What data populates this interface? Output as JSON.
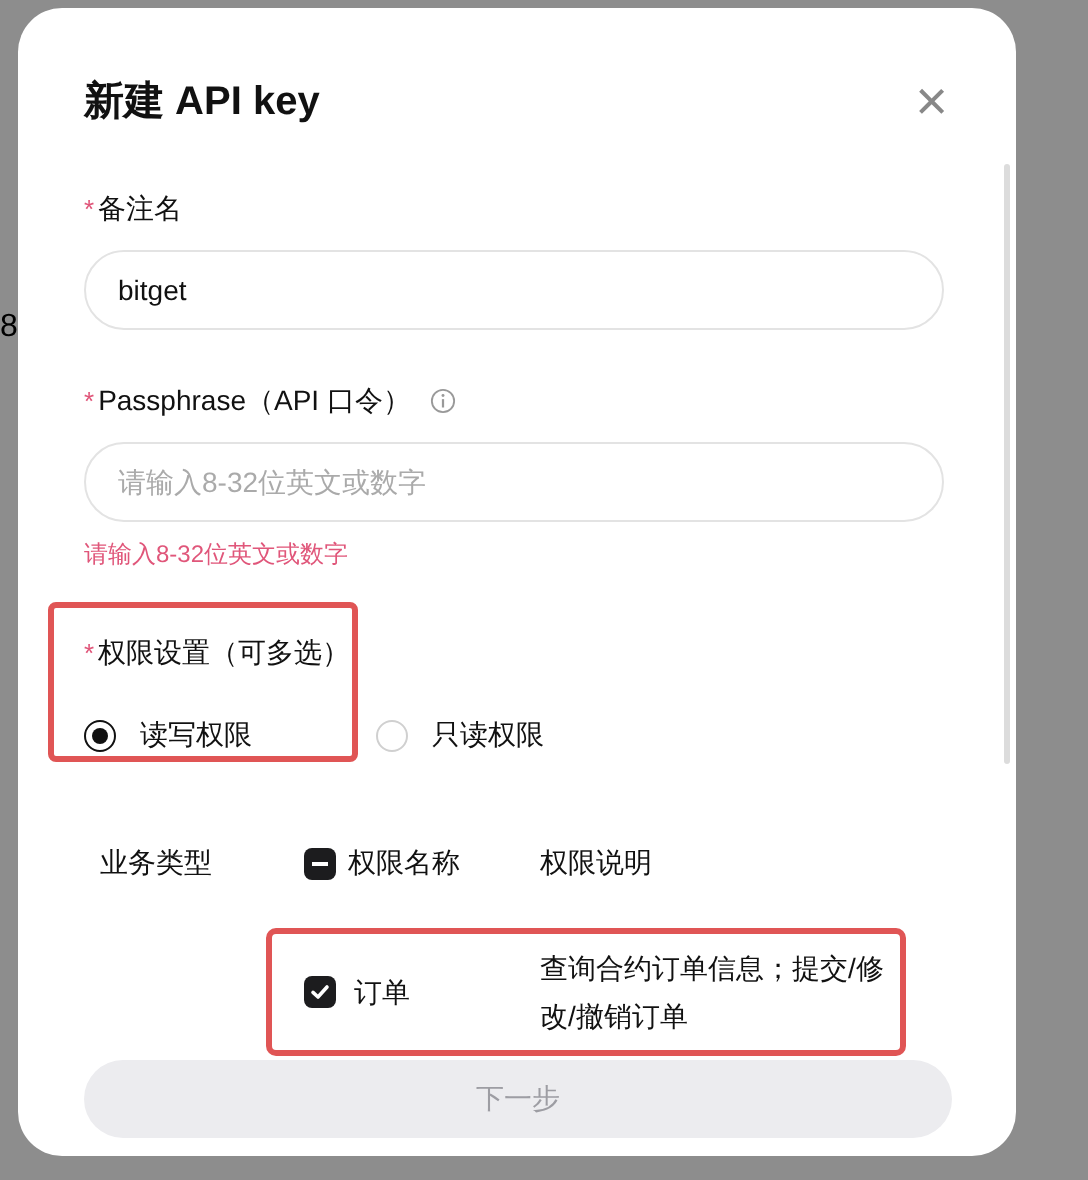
{
  "backdrop_text": "8",
  "dialog": {
    "title": "新建 API key",
    "close": "×"
  },
  "fields": [
    {
      "label": "备注名",
      "required_mark": "*",
      "value": "bitget"
    },
    {
      "label": "Passphrase（API 口令）",
      "required_mark": "*",
      "placeholder": "请输入8-32位英文或数字",
      "info": true,
      "error": "请输入8-32位英文或数字"
    }
  ],
  "permission": {
    "label": "权限设置（可多选）",
    "required_mark": "*",
    "highlighted": true,
    "options": [
      {
        "label": "读写权限",
        "selected": true
      },
      {
        "label": "只读权限",
        "selected": false
      }
    ]
  },
  "table": {
    "columns": [
      "业务类型",
      "权限名称",
      "权限说明"
    ],
    "header_partial": true,
    "rows": [
      {
        "type": "",
        "name": "订单",
        "description": "查询合约订单信息；提交/修改/撤销订单",
        "checked": true,
        "highlighted": true
      }
    ]
  },
  "next_button": {
    "label": "下一步",
    "disabled": true
  }
}
